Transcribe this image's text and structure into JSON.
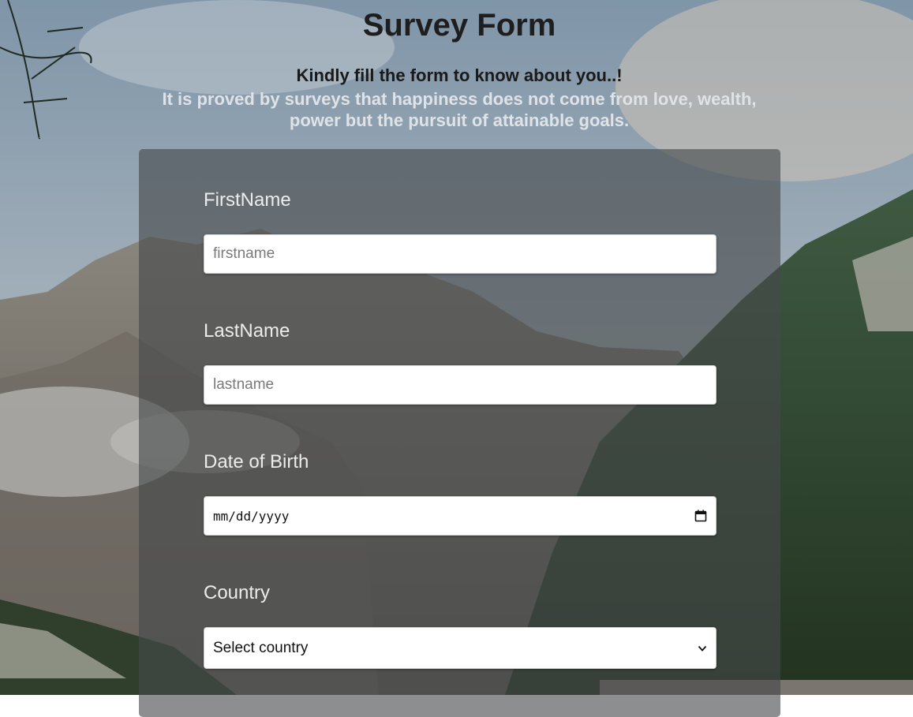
{
  "header": {
    "title": "Survey Form",
    "subtitle": "Kindly fill the form to know about you..!",
    "quote": "It is proved by surveys that happiness does not come from love, wealth, power but the pursuit of attainable goals."
  },
  "form": {
    "firstname": {
      "label": "FirstName",
      "placeholder": "firstname",
      "value": ""
    },
    "lastname": {
      "label": "LastName",
      "placeholder": "lastname",
      "value": ""
    },
    "dob": {
      "label": "Date of Birth",
      "placeholder": "mm/dd/yyyy",
      "icon": "calendar-icon"
    },
    "country": {
      "label": "Country",
      "selected": "Select country",
      "icon": "chevron-down-icon"
    }
  },
  "colors": {
    "title": "#1e1e1e",
    "quote": "#dfe3e7",
    "panel": "rgba(70,72,74,0.62)",
    "label": "#ececec"
  }
}
